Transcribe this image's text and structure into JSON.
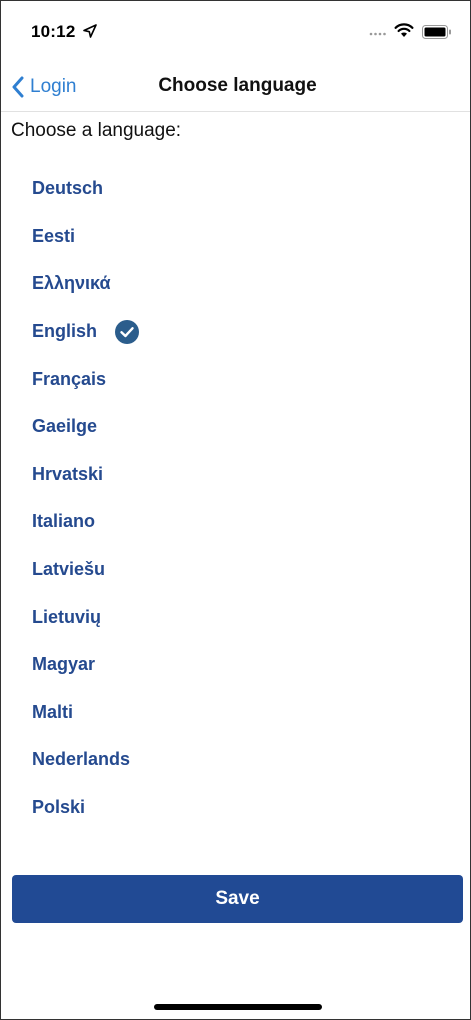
{
  "status_bar": {
    "time": "10:12",
    "location_icon": "location-arrow-icon",
    "signal_icon": "signal-dots-icon",
    "wifi_icon": "wifi-icon",
    "battery_icon": "battery-icon"
  },
  "nav": {
    "back_label": "Login",
    "back_icon": "chevron-left-icon",
    "title": "Choose language"
  },
  "content": {
    "prompt": "Choose a language:",
    "languages": [
      {
        "label": "Deutsch",
        "selected": false
      },
      {
        "label": "Eesti",
        "selected": false
      },
      {
        "label": "Ελληνικά",
        "selected": false
      },
      {
        "label": "English",
        "selected": true
      },
      {
        "label": "Français",
        "selected": false
      },
      {
        "label": "Gaeilge",
        "selected": false
      },
      {
        "label": "Hrvatski",
        "selected": false
      },
      {
        "label": "Italiano",
        "selected": false
      },
      {
        "label": "Latviešu",
        "selected": false
      },
      {
        "label": "Lietuvių",
        "selected": false
      },
      {
        "label": "Magyar",
        "selected": false
      },
      {
        "label": "Malti",
        "selected": false
      },
      {
        "label": "Nederlands",
        "selected": false
      },
      {
        "label": "Polski",
        "selected": false
      }
    ],
    "selected_icon": "checkmark-circle-icon"
  },
  "actions": {
    "save_label": "Save"
  },
  "colors": {
    "link_blue": "#2f7fd1",
    "language_text": "#254a8f",
    "primary_button": "#214a94",
    "check_circle": "#2b5d8c"
  }
}
